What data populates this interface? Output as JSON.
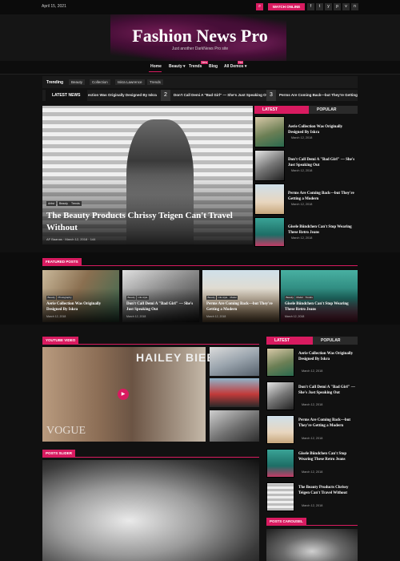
{
  "topbar": {
    "date": "April 15, 2021",
    "watch_label": "WATCH ONLINE",
    "social": [
      "f",
      "t",
      "y",
      "p",
      "v",
      "n"
    ]
  },
  "header": {
    "title": "Fashion News Pro",
    "tagline": "Just another DarkNews Pro site"
  },
  "nav": {
    "items": [
      "Home",
      "Beauty ▾",
      "Trends",
      "Blog",
      "All Demos ▾"
    ],
    "new_badge": "New",
    "hot_badge": "Hot"
  },
  "trending": {
    "label": "Trending",
    "tags": [
      "Beauty",
      "Collection",
      "Iskra Lawrence",
      "Trends"
    ]
  },
  "latest_news": {
    "label": "LATEST NEWS",
    "items": [
      {
        "num": "",
        "text": "ection Was Originally Designed By Iskra"
      },
      {
        "num": "2",
        "text": "Don't Call Demi A \"Bad Girl\" — She's Just Speaking Out"
      },
      {
        "num": "3",
        "text": "Perms Are Coming Back—but They're Getting a Mode"
      }
    ]
  },
  "hero": {
    "chips": [
      "Artist",
      "Beauty",
      "Trends"
    ],
    "title": "The Beauty Products Chrissy Teigen Can't Travel Without",
    "meta": "AF Baanas  ·  March 12, 2018  ·  144"
  },
  "side_tabs_1": {
    "latest": "LATEST",
    "popular": "POPULAR",
    "items": [
      {
        "title": "Aerie Collection Was Originally Designed By Iskra",
        "date": "March 12, 2018"
      },
      {
        "title": "Don't Call Demi A \"Bad Girl\" — She's Just Speaking Out",
        "date": "March 12, 2018"
      },
      {
        "title": "Perms Are Coming Back—but They're Getting a Modern",
        "date": "March 12, 2018"
      },
      {
        "title": "Gisele Bündchen Can't Stop Wearing These Retro Jeans",
        "date": "March 12, 2018"
      }
    ]
  },
  "featured": {
    "label": "FEATURED POSTS",
    "cards": [
      {
        "chips": [
          "Beauty",
          "Photography"
        ],
        "title": "Aerie Collection Was Originally Designed By Iskra",
        "date": "March 12, 2018"
      },
      {
        "chips": [
          "Beauty",
          "Life style"
        ],
        "title": "Don't Call Demi A \"Bad Girl\" — She's Just Speaking Out",
        "date": "March 12, 2018"
      },
      {
        "chips": [
          "Beauty",
          "Life style",
          "Model"
        ],
        "title": "Perms Are Coming Back—but They're Getting a Modern",
        "date": "March 12, 2018"
      },
      {
        "chips": [
          "Beauty",
          "Model",
          "Trends"
        ],
        "title": "Gisele Bündchen Can't Stop Wearing These Retro Jeans",
        "date": "March 12, 2018"
      }
    ]
  },
  "video": {
    "label": "YOUTUBE VIDEO",
    "overlay": "HAILEY BIEBER",
    "brand": "VOGUE"
  },
  "side_tabs_2": {
    "latest": "LATEST",
    "popular": "POPULAR",
    "items": [
      {
        "title": "Aerie Collection Was Originally Designed By Iskra",
        "date": "March 12, 2018"
      },
      {
        "title": "Don't Call Demi A \"Bad Girl\" — She's Just Speaking Out",
        "date": "March 12, 2018"
      },
      {
        "title": "Perms Are Coming Back—but They're Getting a Modern",
        "date": "March 12, 2018"
      },
      {
        "title": "Gisele Bündchen Can't Stop Wearing These Retro Jeans",
        "date": "March 12, 2018"
      },
      {
        "title": "The Beauty Products Chrissy Teigen Can't Travel Without",
        "date": "March 12, 2018"
      }
    ]
  },
  "slider": {
    "label": "POSTS SLIDER"
  },
  "carousel": {
    "label": "POSTS CAROUSEL"
  }
}
